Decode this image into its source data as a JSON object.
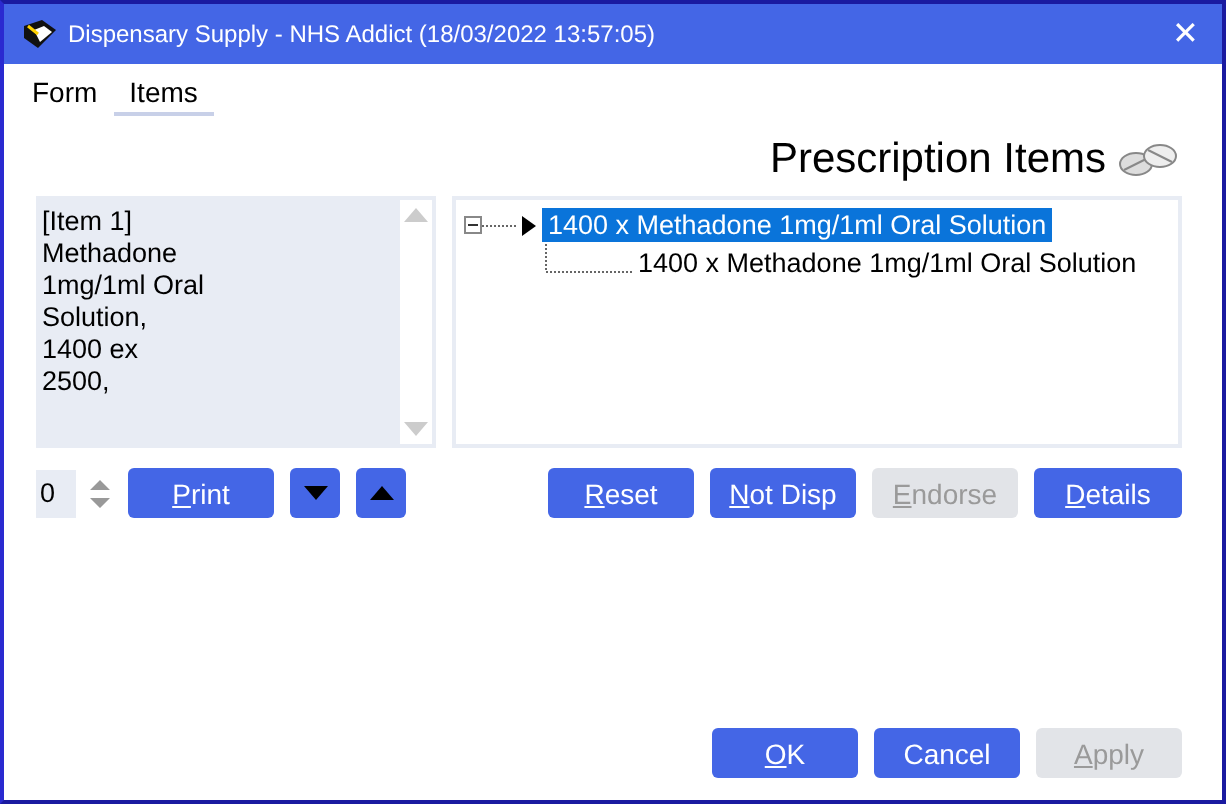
{
  "window": {
    "title": "Dispensary Supply - NHS Addict (18/03/2022 13:57:05)",
    "close": "✕"
  },
  "tabs": [
    {
      "label": "Form",
      "selected": false
    },
    {
      "label": "Items",
      "selected": true
    }
  ],
  "heading": "Prescription Items",
  "item_text": [
    "[Item 1]",
    "Methadone",
    "1mg/1ml Oral",
    "Solution,",
    "1400 ex",
    "2500,"
  ],
  "tree": [
    {
      "label": "1400 x Methadone 1mg/1ml Oral Solution",
      "selected": true,
      "expanded": true,
      "children": [
        {
          "label": "1400 x Methadone 1mg/1ml Oral Solution",
          "selected": false
        }
      ]
    }
  ],
  "copies": "0",
  "left_buttons": [
    {
      "kind": "text",
      "label": "Print",
      "mnemonic": true,
      "disabled": false
    },
    {
      "kind": "down",
      "disabled": false
    },
    {
      "kind": "up",
      "disabled": false
    }
  ],
  "item_buttons": [
    {
      "label": "Reset",
      "mnemonic": true,
      "disabled": false
    },
    {
      "label": "Not Disp",
      "mnemonic": true,
      "disabled": false
    },
    {
      "label": "Endorse",
      "mnemonic": true,
      "disabled": true
    },
    {
      "label": "Details",
      "mnemonic": true,
      "disabled": false
    }
  ],
  "dialog_buttons": [
    {
      "label": "OK",
      "mnemonic": true,
      "disabled": false
    },
    {
      "label": "Cancel",
      "mnemonic": false,
      "disabled": false
    },
    {
      "label": "Apply",
      "mnemonic": true,
      "disabled": true
    }
  ]
}
